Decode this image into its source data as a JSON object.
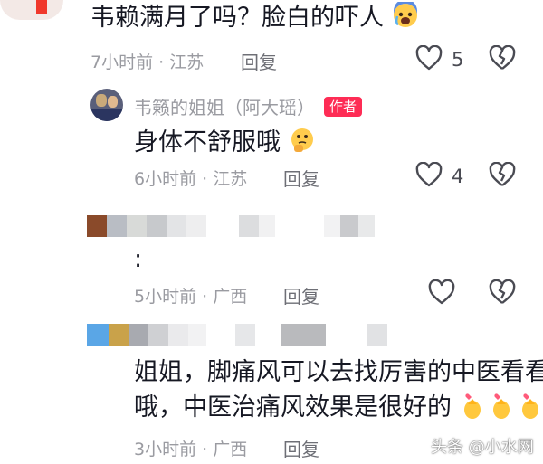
{
  "comment1": {
    "text": "韦赖满月了吗？脸白的吓人",
    "meta": "7小时前 · 江苏",
    "reply_label": "回复",
    "like_count": "5",
    "emoji": "scared-crying-emoji"
  },
  "reply1": {
    "username": "韦籁的姐姐（阿大瑶）",
    "badge": "作者",
    "text": "身体不舒服哦",
    "meta": "6小时前 · 江苏",
    "reply_label": "回复",
    "like_count": "4",
    "emoji": "thinking-emoji"
  },
  "comment2": {
    "text": ":",
    "meta": "5小时前 · 广西",
    "reply_label": "回复",
    "like_count": ""
  },
  "comment3": {
    "text_line1": "姐姐，脚痛风可以去找厉害的中医看看",
    "text_line2": "哦，中医治痛风效果是很好的",
    "meta": "3小时前 · 广西",
    "reply_label": "回复",
    "emoji": "finger-heart-emoji"
  },
  "watermark": {
    "text": "头条 @小水网"
  },
  "colors": {
    "badge": "#fe2c55",
    "meta": "#9a9ba1",
    "text": "#161823"
  }
}
